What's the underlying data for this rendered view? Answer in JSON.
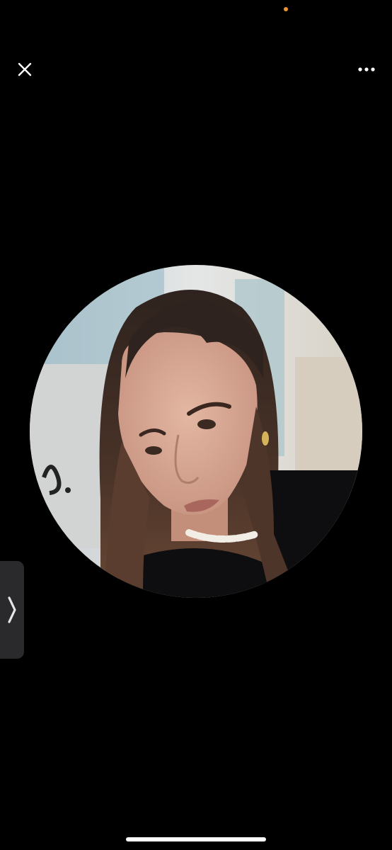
{
  "colors": {
    "background": "#000000",
    "icon": "#ffffff",
    "status_dot": "#f0962e",
    "handle": "#2a2a2c"
  },
  "icons": {
    "close": "close-icon",
    "more": "more-horizontal-icon",
    "handle": "chevron-right-icon"
  }
}
